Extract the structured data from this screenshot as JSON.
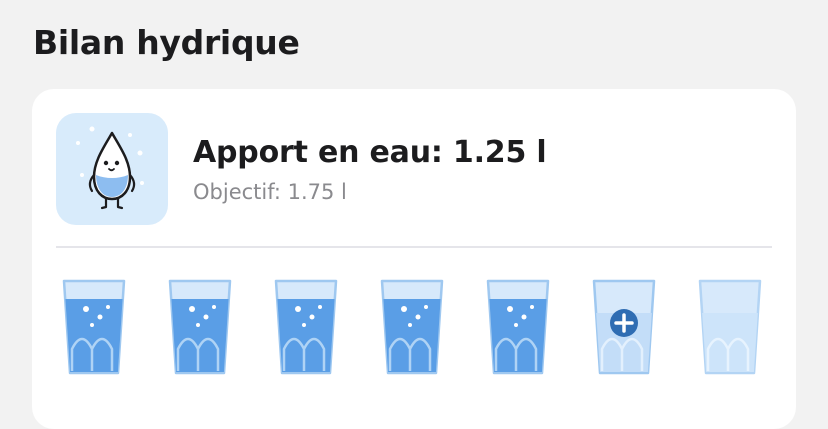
{
  "section": {
    "title": "Bilan hydrique"
  },
  "card": {
    "mascot_icon": "water-drop-mascot-icon",
    "intake_label": "Apport en eau: 1.25 l",
    "goal_label": "Objectif: 1.75 l",
    "glasses": [
      {
        "state": "full",
        "icon": "full-glass-icon"
      },
      {
        "state": "full",
        "icon": "full-glass-icon"
      },
      {
        "state": "full",
        "icon": "full-glass-icon"
      },
      {
        "state": "full",
        "icon": "full-glass-icon"
      },
      {
        "state": "full",
        "icon": "full-glass-icon"
      },
      {
        "state": "add",
        "icon": "add-glass-icon"
      },
      {
        "state": "empty",
        "icon": "empty-glass-icon"
      }
    ]
  },
  "colors": {
    "page_background": "#f2f2f2",
    "card_background": "#ffffff",
    "tile_background": "#d8ebfb",
    "water": "#5a9ee6",
    "glass_rim": "#9fc8f0",
    "glass_empty": "#d7e9fb",
    "add_badge": "#2f6db3",
    "muted_text": "#8a8a8e"
  }
}
